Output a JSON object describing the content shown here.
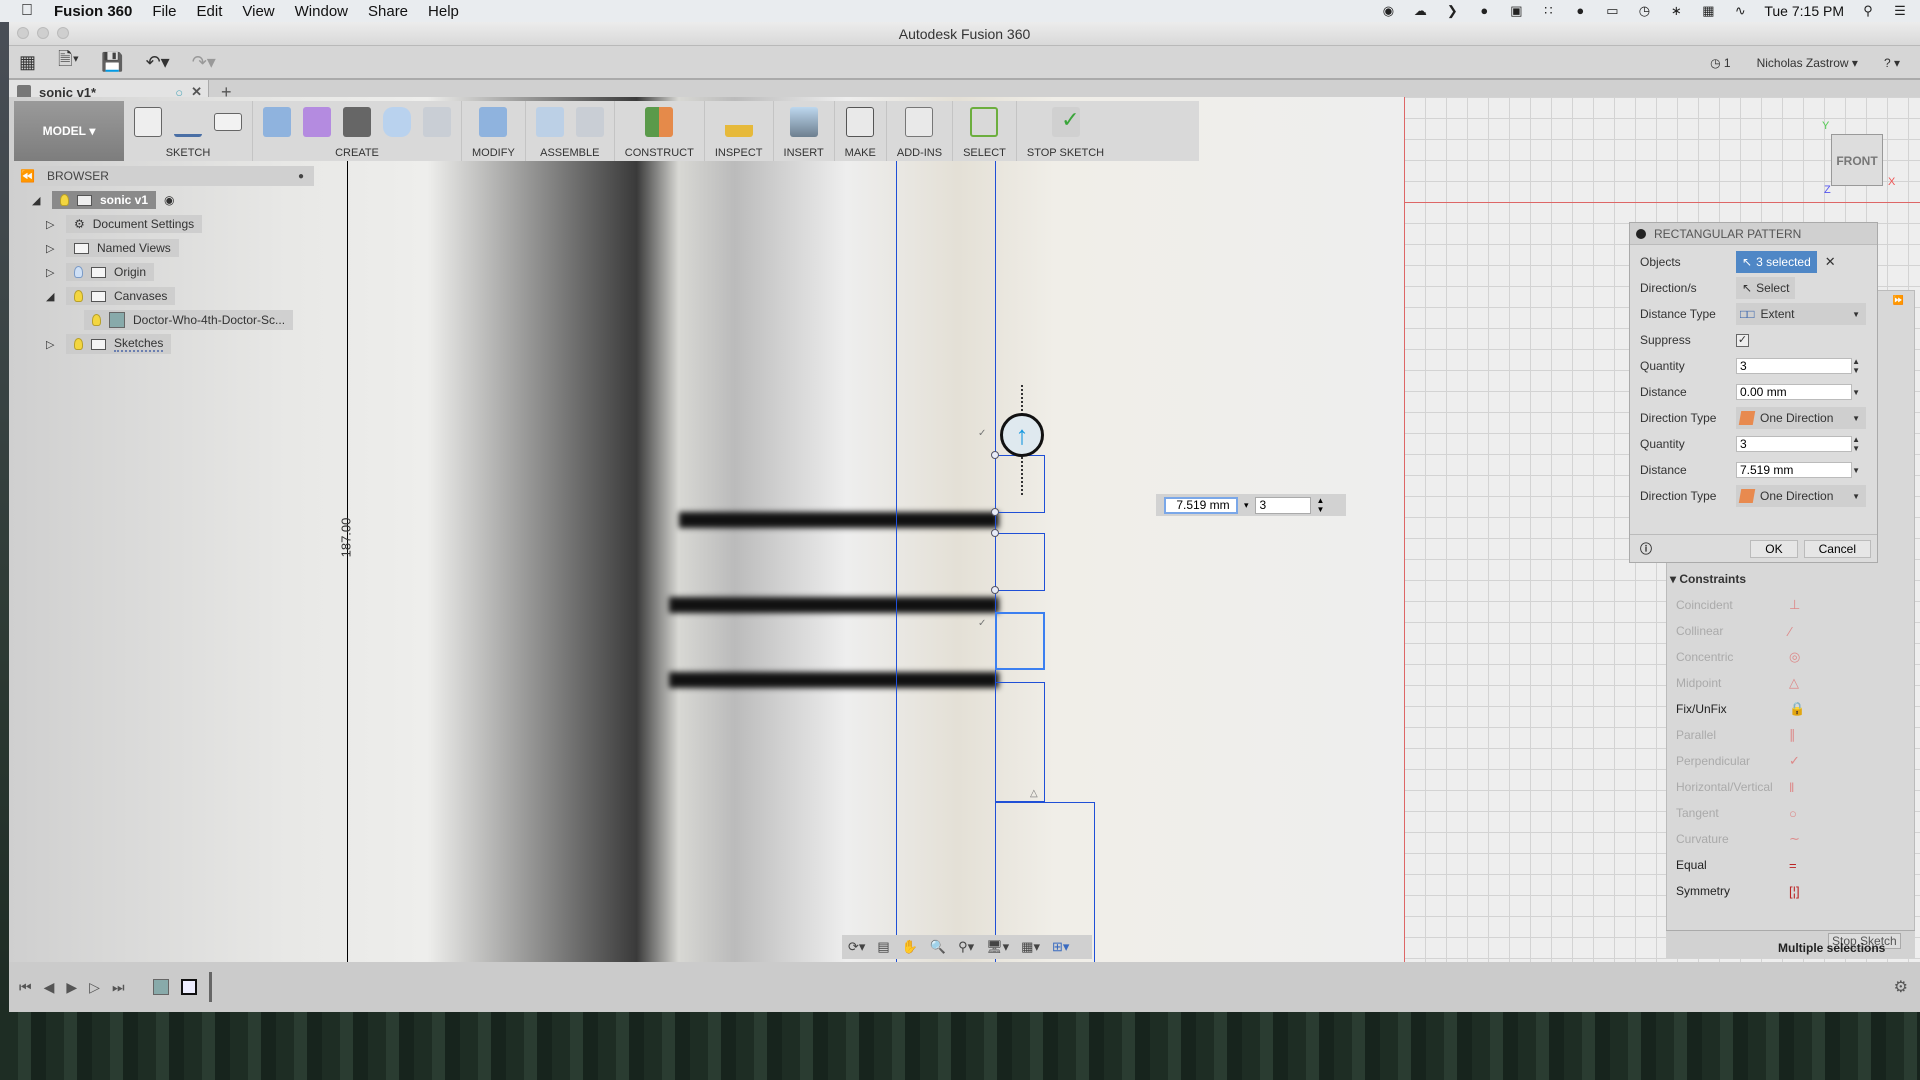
{
  "menubar": {
    "app": "Fusion 360",
    "items": [
      "File",
      "Edit",
      "View",
      "Window",
      "Share",
      "Help"
    ],
    "clock": "Tue 7:15 PM"
  },
  "window": {
    "title": "Autodesk Fusion 360"
  },
  "qat": {
    "job_count": "1",
    "user": "Nicholas Zastrow",
    "help": "?"
  },
  "tab": {
    "name": "sonic v1*"
  },
  "toolbar": {
    "workspace": "MODEL",
    "groups": [
      "SKETCH",
      "CREATE",
      "MODIFY",
      "ASSEMBLE",
      "CONSTRUCT",
      "INSPECT",
      "INSERT",
      "MAKE",
      "ADD-INS",
      "SELECT",
      "STOP SKETCH"
    ]
  },
  "browser": {
    "title": "BROWSER",
    "root": "sonic v1",
    "items": [
      "Document Settings",
      "Named Views",
      "Origin",
      "Canvases",
      "Doctor-Who-4th-Doctor-Sc...",
      "Sketches"
    ]
  },
  "canvas": {
    "dimension": "187.00"
  },
  "inline_input": {
    "distance": "7.519 mm",
    "quantity": "3"
  },
  "dialog": {
    "title": "RECTANGULAR PATTERN",
    "objects_label": "Objects",
    "objects_value": "3 selected",
    "directions_label": "Direction/s",
    "directions_value": "Select",
    "distance_type_label": "Distance Type",
    "distance_type_value": "Extent",
    "suppress_label": "Suppress",
    "suppress_checked": true,
    "quantity1_label": "Quantity",
    "quantity1_value": "3",
    "distance1_label": "Distance",
    "distance1_value": "0.00 mm",
    "direction_type1_label": "Direction Type",
    "direction_type1_value": "One Direction",
    "quantity2_label": "Quantity",
    "quantity2_value": "3",
    "distance2_label": "Distance",
    "distance2_value": "7.519 mm",
    "direction_type2_label": "Direction Type",
    "direction_type2_value": "One Direction",
    "ok": "OK",
    "cancel": "Cancel"
  },
  "constraints": {
    "title": "Constraints",
    "items": [
      {
        "label": "Coincident",
        "enabled": false
      },
      {
        "label": "Collinear",
        "enabled": false
      },
      {
        "label": "Concentric",
        "enabled": false
      },
      {
        "label": "Midpoint",
        "enabled": false
      },
      {
        "label": "Fix/UnFix",
        "enabled": true
      },
      {
        "label": "Parallel",
        "enabled": false
      },
      {
        "label": "Perpendicular",
        "enabled": false
      },
      {
        "label": "Horizontal/Vertical",
        "enabled": false
      },
      {
        "label": "Tangent",
        "enabled": false
      },
      {
        "label": "Curvature",
        "enabled": false
      },
      {
        "label": "Equal",
        "enabled": true
      },
      {
        "label": "Symmetry",
        "enabled": true
      }
    ],
    "status": "Multiple selections",
    "stop_sketch": "Stop Sketch"
  },
  "viewcube": {
    "face": "FRONT",
    "x": "X",
    "y": "Y",
    "z": "Z"
  }
}
